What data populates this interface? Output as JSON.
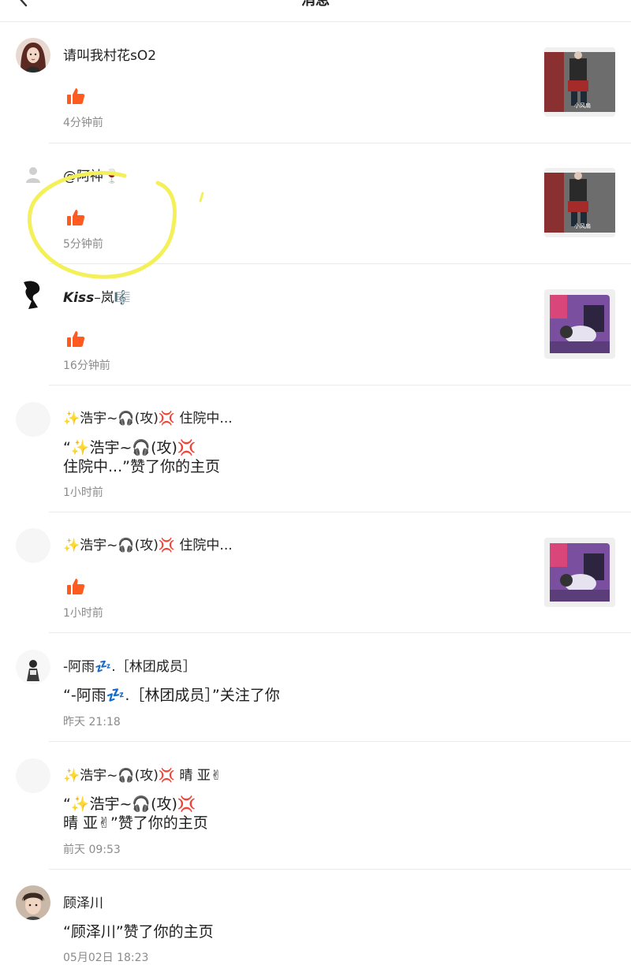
{
  "header": {
    "title": "消息"
  },
  "notifications": [
    {
      "name": "请叫我村花sO2",
      "time": "4分钟前",
      "has_like": true,
      "thumb": "dance-photo"
    },
    {
      "name": "@阿神🍷",
      "time": "5分钟前",
      "has_like": true,
      "thumb": "dance-photo"
    },
    {
      "name_bold": "Kiss",
      "name_rest": "–岚🎼",
      "time": "16分钟前",
      "has_like": true,
      "thumb": "cartoon-scene"
    },
    {
      "name": "✨浩宇~🎧(攻)💢 住院中...",
      "message": "“✨浩宇~🎧(攻)💢\n住院中...”赞了你的主页",
      "time": "1小时前"
    },
    {
      "name": "✨浩宇~🎧(攻)💢 住院中...",
      "time": "1小时前",
      "has_like": true,
      "thumb": "cartoon-scene"
    },
    {
      "name": "-阿雨💤.［林团成员］",
      "message": "“-阿雨💤.［林团成员］”关注了你",
      "time": "昨天 21:18"
    },
    {
      "name": "✨浩宇~🎧(攻)💢 晴 亚✌",
      "message": "“✨浩宇~🎧(攻)💢\n晴 亚✌”赞了你的主页",
      "time": "前天 09:53"
    },
    {
      "name": "顾泽川",
      "message": "“顾泽川”赞了你的主页",
      "time": "05月02日 18:23"
    }
  ],
  "colors": {
    "like": "#ff5a1f",
    "annotation": "#f4f05a",
    "time": "#8b8b8b"
  }
}
